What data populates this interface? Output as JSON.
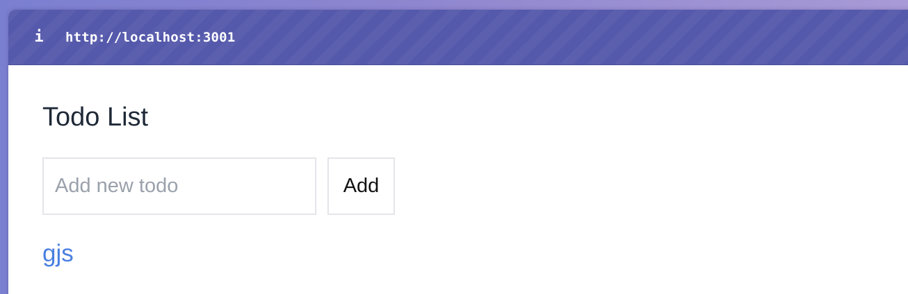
{
  "titlebar": {
    "icon": "info-icon",
    "icon_glyph": "i",
    "url": "http://localhost:3001"
  },
  "page": {
    "title": "Todo List"
  },
  "form": {
    "input_value": "",
    "input_placeholder": "Add new todo",
    "add_label": "Add"
  },
  "todos": [
    {
      "label": "gjs"
    }
  ],
  "colors": {
    "titlebar_bg": "#5559ab",
    "link": "#4a7fe0",
    "heading": "#1f2937"
  }
}
